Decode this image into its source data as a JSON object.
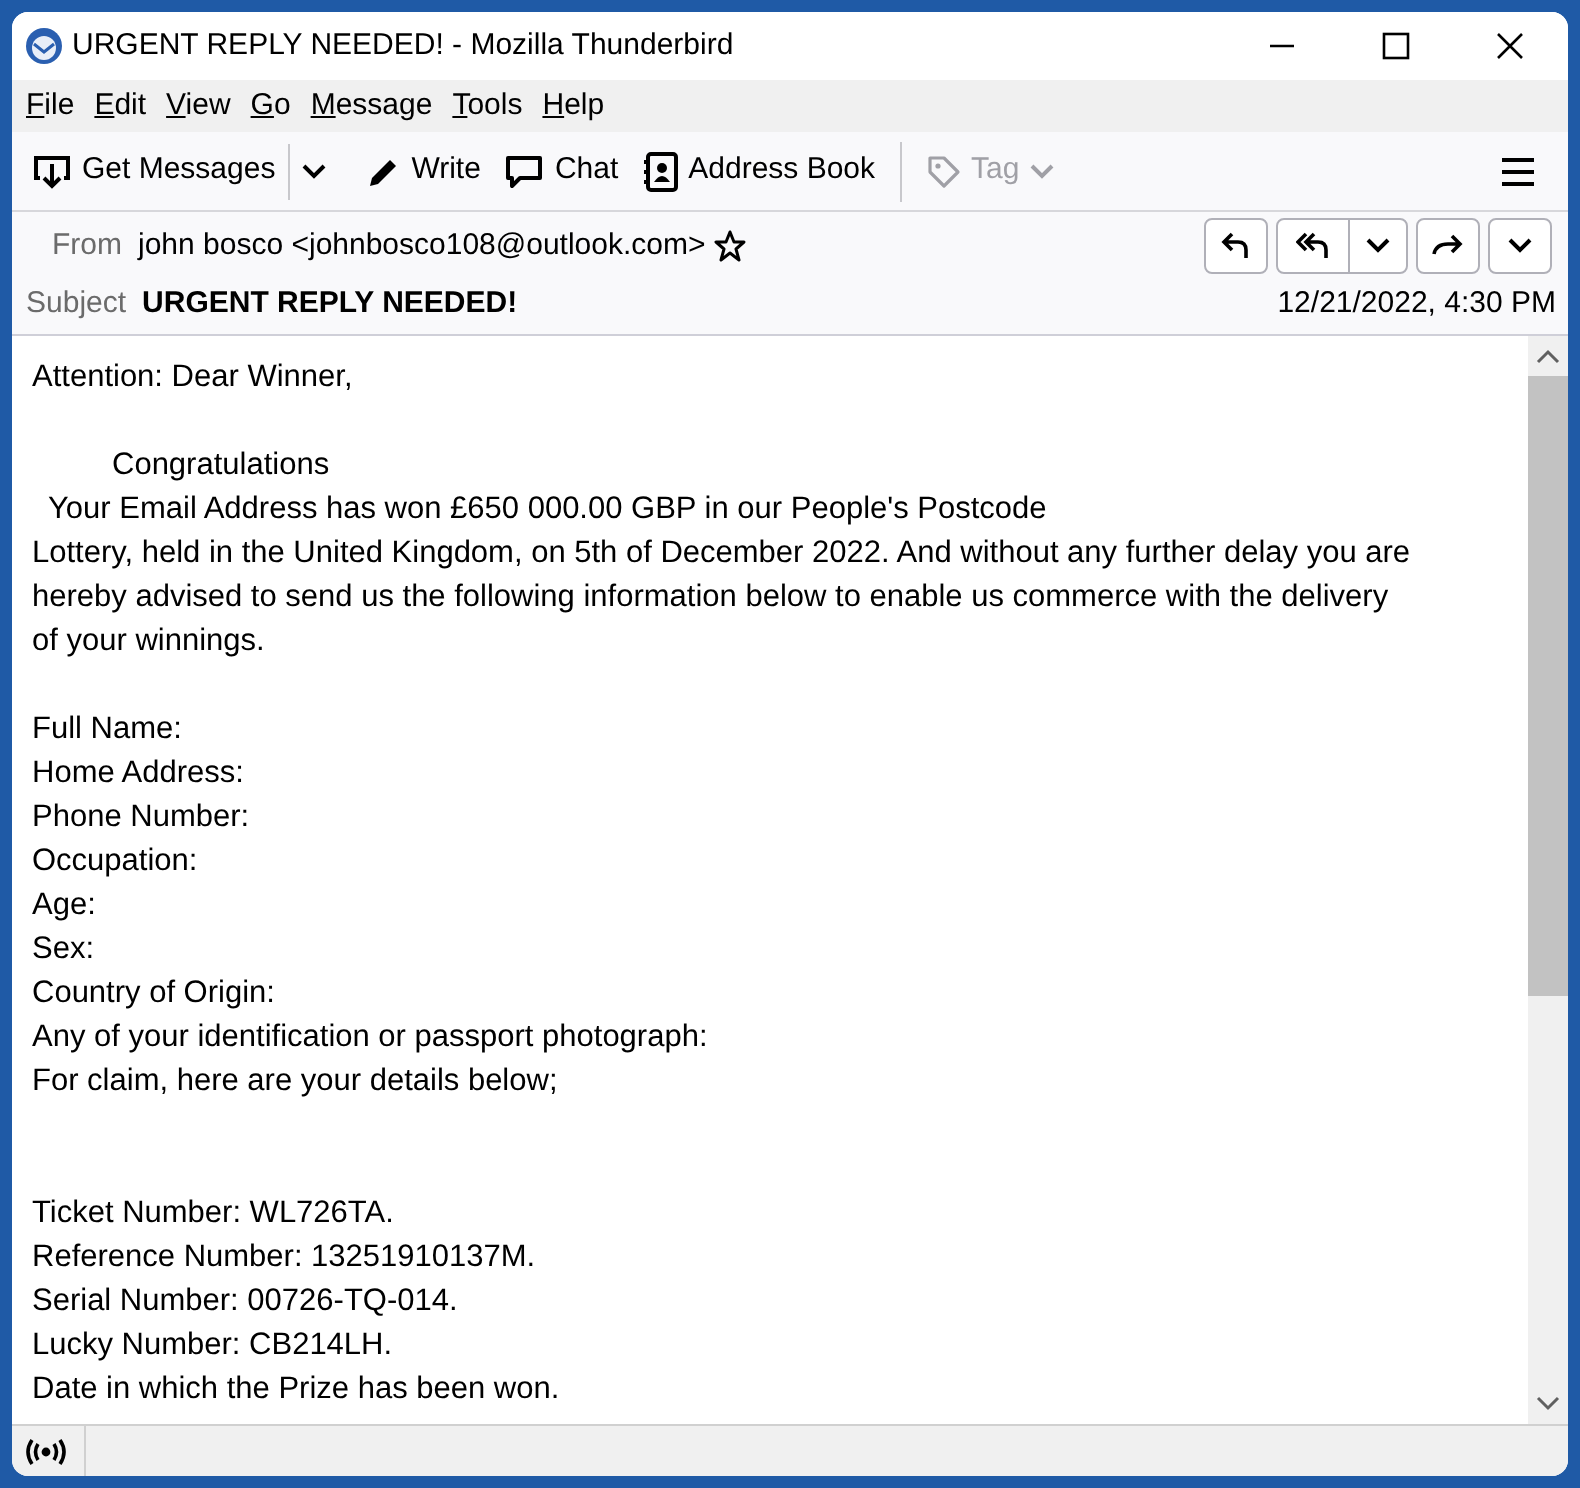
{
  "window": {
    "title": "URGENT REPLY NEEDED! - Mozilla Thunderbird"
  },
  "menu": [
    "File",
    "Edit",
    "View",
    "Go",
    "Message",
    "Tools",
    "Help"
  ],
  "toolbar": [
    {
      "kind": "get",
      "label": "Get Messages",
      "disabled": false
    },
    {
      "kind": "write",
      "label": "Write",
      "disabled": false
    },
    {
      "kind": "chat",
      "label": "Chat",
      "disabled": false
    },
    {
      "kind": "addressbook",
      "label": "Address Book",
      "disabled": false
    },
    {
      "kind": "tag",
      "label": "Tag",
      "disabled": true
    }
  ],
  "header": {
    "from_label": "From",
    "from": "john bosco <johnbosco108@outlook.com>",
    "starred": false,
    "subject_label": "Subject",
    "subject": "URGENT REPLY NEEDED!",
    "date": "12/21/2022, 4:30 PM"
  },
  "body": [
    {
      "kind": "first",
      "lines": [
        {
          "kind": "plain",
          "text": "Attention: Dear Winner,"
        }
      ]
    },
    {
      "kind": "normal",
      "lines": [
        {
          "kind": "indent",
          "text": "Congratulations"
        },
        {
          "kind": "nudge",
          "text": "Your Email Address has won £650 000.00 GBP in our People's Postcode"
        },
        {
          "kind": "plain",
          "text": "Lottery, held in the United Kingdom, on 5th of December 2022. And without any further delay you are"
        },
        {
          "kind": "plain",
          "text": "hereby advised to send us the following information below to enable us commerce with the delivery"
        },
        {
          "kind": "plain",
          "text": "of your winnings."
        }
      ]
    },
    {
      "kind": "normal",
      "lines": [
        {
          "kind": "plain",
          "text": "Full Name:"
        },
        {
          "kind": "plain",
          "text": "Home Address:"
        },
        {
          "kind": "plain",
          "text": "Phone Number:"
        },
        {
          "kind": "plain",
          "text": "Occupation:"
        },
        {
          "kind": "plain",
          "text": "Age:"
        },
        {
          "kind": "plain",
          "text": "Sex:"
        },
        {
          "kind": "plain",
          "text": "Country of Origin:"
        },
        {
          "kind": "plain",
          "text": "Any of your identification or passport photograph:"
        },
        {
          "kind": "plain",
          "text": "For claim, here are your details below;"
        }
      ]
    },
    {
      "kind": "wide",
      "lines": [
        {
          "kind": "plain",
          "text": "Ticket Number: WL726TA."
        },
        {
          "kind": "plain",
          "text": "Reference Number: 13251910137M."
        },
        {
          "kind": "plain",
          "text": "Serial Number: 00726-TQ-014."
        },
        {
          "kind": "plain",
          "text": "Lucky Number: CB214LH."
        },
        {
          "kind": "plain",
          "text": "Date in which the Prize has been won."
        }
      ]
    }
  ]
}
